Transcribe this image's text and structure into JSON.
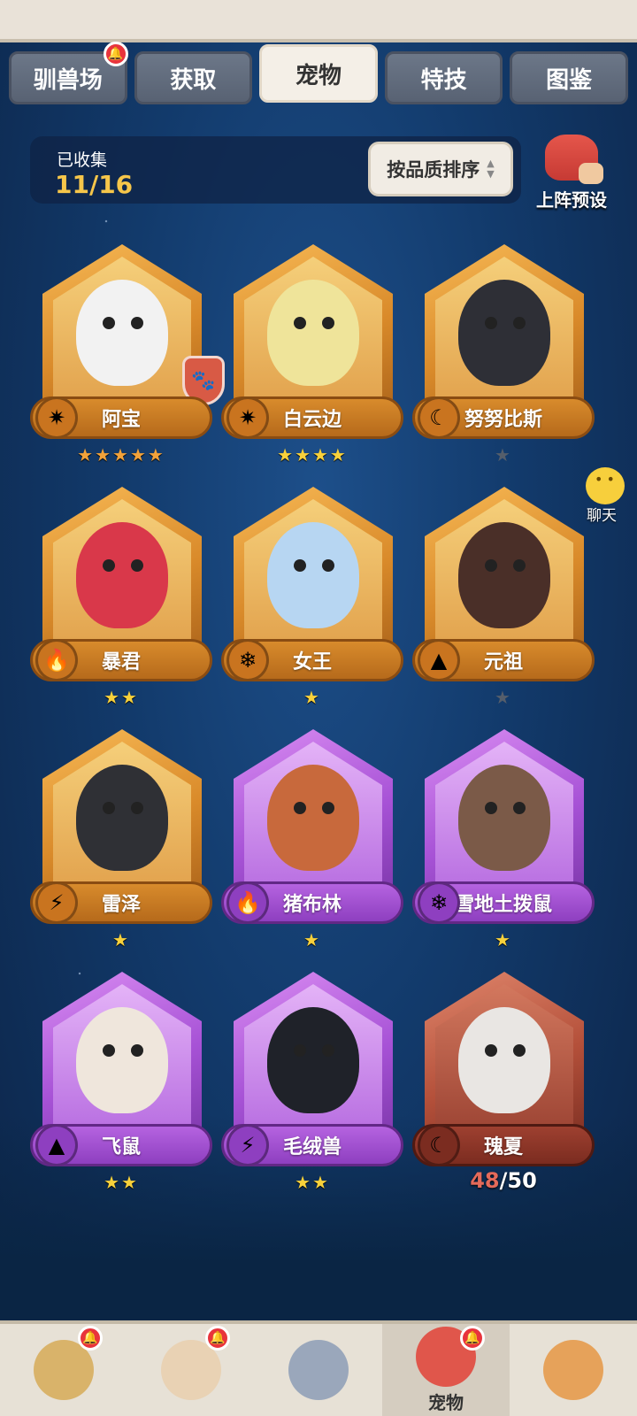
{
  "tabs": [
    {
      "label": "驯兽场",
      "has_alert": true
    },
    {
      "label": "获取",
      "has_alert": false
    },
    {
      "label": "宠物",
      "has_alert": false,
      "active": true
    },
    {
      "label": "特技",
      "has_alert": false
    },
    {
      "label": "图鉴",
      "has_alert": false
    }
  ],
  "collection": {
    "label": "已收集",
    "value": "11/16"
  },
  "sort_button": {
    "label": "按品质排序"
  },
  "preset_button": {
    "label": "上阵预设"
  },
  "chat_button": {
    "label": "聊天"
  },
  "pets": [
    {
      "name": "阿宝",
      "element": "star-icon",
      "rarity": "gold",
      "stars": "★★★★★",
      "star_color": "orange",
      "body_color": "#f2f2f2",
      "has_badge": true
    },
    {
      "name": "白云边",
      "element": "star-icon",
      "rarity": "gold",
      "stars": "★★★★",
      "star_color": "gold",
      "body_color": "#efe49a"
    },
    {
      "name": "努努比斯",
      "element": "moon-icon",
      "rarity": "gold",
      "stars": "★",
      "star_color": "grey",
      "body_color": "#2e2f36"
    },
    {
      "name": "暴君",
      "element": "fire-icon",
      "rarity": "gold",
      "stars": "★★",
      "star_color": "gold",
      "body_color": "#d9384a"
    },
    {
      "name": "女王",
      "element": "snowflake-icon",
      "rarity": "gold",
      "stars": "★",
      "star_color": "gold",
      "body_color": "#b7d6f2"
    },
    {
      "name": "元祖",
      "element": "mountain-icon",
      "rarity": "gold",
      "stars": "★",
      "star_color": "grey",
      "body_color": "#4a2f28"
    },
    {
      "name": "雷泽",
      "element": "lightning-icon",
      "rarity": "gold",
      "stars": "★",
      "star_color": "gold",
      "body_color": "#2f3035"
    },
    {
      "name": "猪布林",
      "element": "fire-icon",
      "rarity": "purple",
      "stars": "★",
      "star_color": "gold",
      "body_color": "#c8693c"
    },
    {
      "name": "雪地土拨鼠",
      "element": "snowflake-icon",
      "rarity": "purple",
      "stars": "★",
      "star_color": "gold",
      "body_color": "#7b5a48"
    },
    {
      "name": "飞鼠",
      "element": "mountain-icon",
      "rarity": "purple",
      "stars": "★★",
      "star_color": "gold",
      "body_color": "#efe6dc"
    },
    {
      "name": "毛绒兽",
      "element": "lightning-icon",
      "rarity": "purple",
      "stars": "★★",
      "star_color": "gold",
      "body_color": "#1f2229"
    },
    {
      "name": "瑰夏",
      "element": "moon-icon",
      "rarity": "red",
      "progress_current": "48",
      "progress_total": "/50",
      "body_color": "#e9e6e3"
    }
  ],
  "element_glyphs": {
    "star-icon": "✷",
    "moon-icon": "☾",
    "fire-icon": "🔥",
    "snowflake-icon": "❄",
    "mountain-icon": "▲",
    "lightning-icon": "⚡"
  },
  "bottom_nav": [
    {
      "name": "nav-tamer",
      "has_alert": true,
      "color": "#d9b36a"
    },
    {
      "name": "nav-hero",
      "has_alert": true,
      "color": "#e9d2b4"
    },
    {
      "name": "nav-weapon",
      "has_alert": false,
      "color": "#9aa7bb"
    },
    {
      "name": "nav-pet",
      "label": "宠物",
      "has_alert": true,
      "active": true,
      "color": "#e0564b"
    },
    {
      "name": "nav-shop",
      "has_alert": false,
      "color": "#e6a25a"
    }
  ]
}
